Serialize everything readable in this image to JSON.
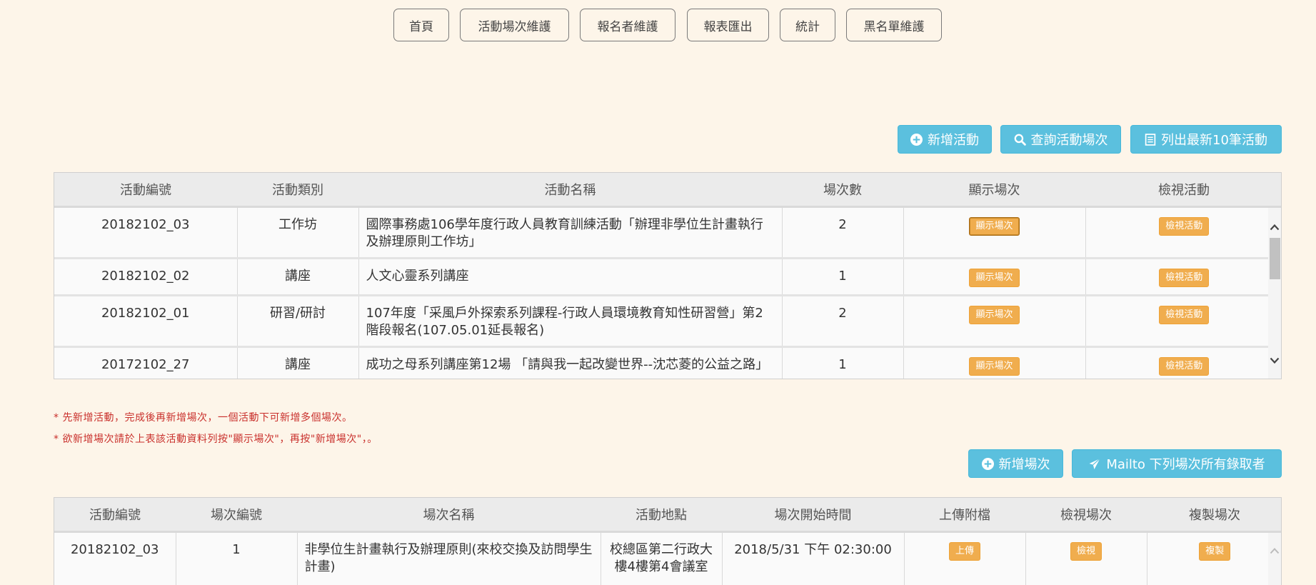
{
  "nav": [
    {
      "label": "首頁"
    },
    {
      "label": "活動場次維護"
    },
    {
      "label": "報名者維護"
    },
    {
      "label": "報表匯出"
    },
    {
      "label": "統計"
    },
    {
      "label": "黑名單維護"
    }
  ],
  "toolbar": {
    "add_activity": "新增活動",
    "query_sessions": "查詢活動場次",
    "list_latest": "列出最新10筆活動"
  },
  "activity_table": {
    "headers": [
      "活動編號",
      "活動類別",
      "活動名稱",
      "場次數",
      "顯示場次",
      "檢視活動"
    ],
    "show_btn": "顯示場次",
    "view_btn": "檢視活動",
    "rows": [
      {
        "id": "20182102_03",
        "category": "工作坊",
        "name": "國際事務處106學年度行政人員教育訓練活動「辦理非學位生計畫執行及辦理原則工作坊」",
        "count": "2"
      },
      {
        "id": "20182102_02",
        "category": "講座",
        "name": "人文心靈系列講座",
        "count": "1"
      },
      {
        "id": "20182102_01",
        "category": "研習/研討",
        "name": "107年度「采風戶外探索系列課程-行政人員環境教育知性研習營」第2階段報名(107.05.01延長報名)",
        "count": "2"
      },
      {
        "id": "20172102_27",
        "category": "講座",
        "name": "成功之母系列講座第12場 「請與我一起改變世界--沈芯菱的公益之路」",
        "count": "1"
      }
    ]
  },
  "notes": {
    "line1": "* 先新增活動，完成後再新增場次，一個活動下可新增多個場次。",
    "line2": "* 欲新增場次請於上表該活動資料列按\"顯示場次\"，再按\"新增場次\"，。"
  },
  "session_toolbar": {
    "add_session": "新增場次",
    "mailto": "Mailto 下列場次所有錄取者"
  },
  "session_table": {
    "headers": [
      "活動編號",
      "場次編號",
      "場次名稱",
      "活動地點",
      "場次開始時間",
      "上傳附檔",
      "檢視場次",
      "複製場次"
    ],
    "upload_btn": "上傳",
    "view_btn": "檢視",
    "copy_btn": "複製",
    "rows": [
      {
        "id": "20182102_03",
        "session_no": "1",
        "name": "非學位生計畫執行及辦理原則(來校交換及訪問學生計畫)",
        "location": "校總區第二行政大樓4樓第4會議室",
        "start": "2018/5/31 下午 02:30:00"
      }
    ]
  },
  "colors": {
    "info": "#5bc0de",
    "warning": "#f0ad4e",
    "background": "#fdf5e9",
    "note": "#c9302c"
  }
}
